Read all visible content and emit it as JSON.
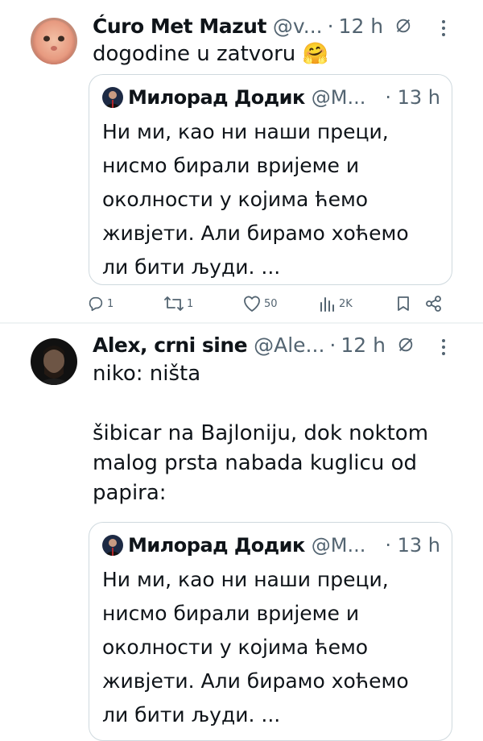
{
  "tweets": [
    {
      "name": "Ćuro Met Mazut",
      "handle": "@v...",
      "dot": "·",
      "time": "12 h",
      "text": "dogodine u zatvoru 🤗",
      "quote": {
        "name": "Милорад Додик",
        "handle": "@M...",
        "time": "· 13 h",
        "text": "Ни ми, као ни наши преци, нисмо бирали вријеме и околности у којима ћемо живјети. Али бирамо хоћемо ли бити људи. ..."
      },
      "actions": {
        "replies": "1",
        "reposts": "1",
        "likes": "50",
        "views": "2K"
      }
    },
    {
      "name": "Alex, crni sine",
      "handle": "@Ale...",
      "dot": "·",
      "time": "12 h",
      "text": "niko: ništa\n\nšibicar na Bajloniju, dok noktom malog prsta nabada kuglicu od papira:",
      "quote": {
        "name": "Милорад Додик",
        "handle": "@M...",
        "time": "· 13 h",
        "text": "Ни ми, као ни наши преци, нисмо бирали вријеме и околности у којима ћемо живјети. Али бирамо хоћемо ли бити људи. ..."
      }
    }
  ],
  "icons": {
    "reply": "reply-icon",
    "repost": "repost-icon",
    "like": "heart-icon",
    "views": "views-icon",
    "bookmark": "bookmark-icon",
    "share": "share-icon",
    "grok": "grok-icon",
    "more": "more-icon"
  },
  "colors": {
    "text": "#0f1419",
    "secondary": "#536471",
    "border": "#cfd9de",
    "divider": "#eff3f4"
  }
}
